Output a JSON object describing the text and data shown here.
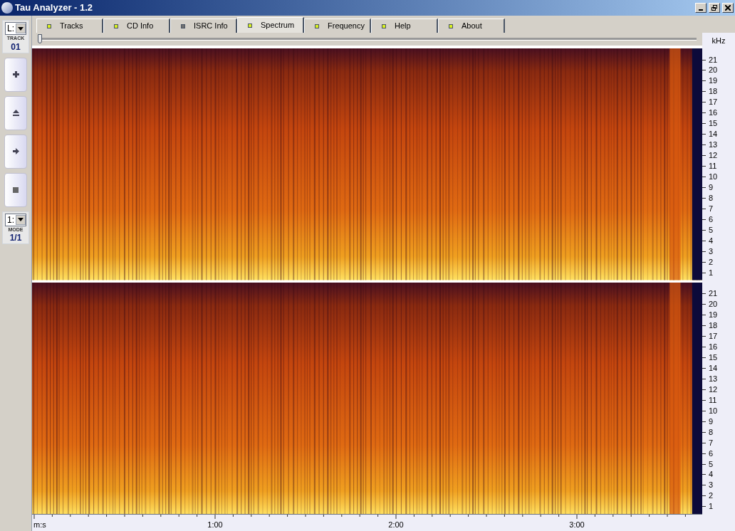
{
  "window": {
    "title": "Tau Analyzer - 1.2"
  },
  "sidebar": {
    "channel_select": "L:",
    "track_label": "TRACK",
    "track_number": "01",
    "mode_select": "1:",
    "mode_label": "MODE",
    "mode_value": "1/1"
  },
  "tabs": [
    {
      "label": "Tracks",
      "selected": false,
      "enabled": true
    },
    {
      "label": "CD Info",
      "selected": false,
      "enabled": true
    },
    {
      "label": "ISRC Info",
      "selected": false,
      "enabled": false
    },
    {
      "label": "Spectrum",
      "selected": true,
      "enabled": true
    },
    {
      "label": "Frequency",
      "selected": false,
      "enabled": true
    },
    {
      "label": "Help",
      "selected": false,
      "enabled": true
    },
    {
      "label": "About",
      "selected": false,
      "enabled": true
    }
  ],
  "position_slider": {
    "level": 0.0
  },
  "frequency_axis": {
    "unit": "kHz"
  },
  "panels": [
    {
      "labels": [
        "21",
        "20",
        "19",
        "18",
        "17",
        "16",
        "15",
        "14",
        "13",
        "12",
        "11",
        "10",
        "9",
        "8",
        "7",
        "6",
        "5",
        "4",
        "3",
        "2",
        "1"
      ]
    },
    {
      "labels": [
        "21",
        "20",
        "19",
        "18",
        "17",
        "16",
        "15",
        "14",
        "13",
        "12",
        "11",
        "10",
        "9",
        "8",
        "7",
        "6",
        "5",
        "4",
        "3",
        "2",
        "1"
      ]
    }
  ],
  "time_axis": {
    "unit": "m:s",
    "labels": [
      "1:00",
      "2:00",
      "3:00"
    ]
  }
}
